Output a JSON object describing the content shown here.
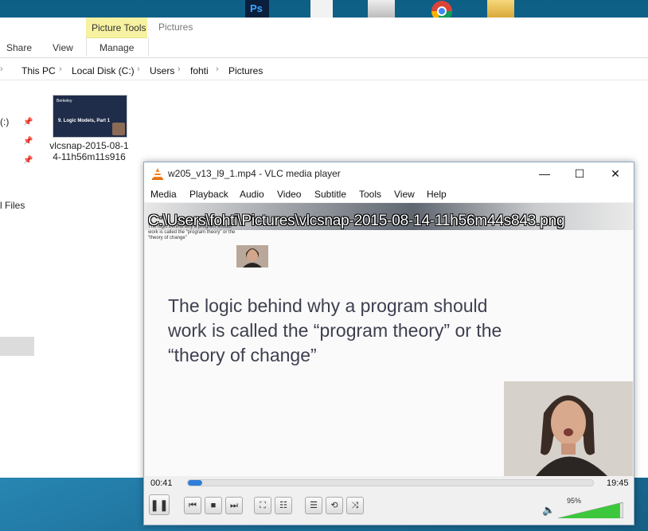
{
  "explorer": {
    "tabs": [
      "Share",
      "View"
    ],
    "contextual_group": "Picture Tools",
    "contextual_tab": "Manage",
    "contextual_tab2": "Pictures",
    "breadcrumb": [
      "This PC",
      "Local Disk (C:)",
      "Users",
      "fohti",
      "Pictures"
    ],
    "nav_partial": [
      "(:)",
      "l Files"
    ],
    "file": {
      "name": "vlcsnap-2015-08-14-11h56m11s916",
      "thumb_title": "9. Logic Models, Part 1",
      "thumb_logo": "Berkeley"
    }
  },
  "vlc": {
    "title": "w205_v13_l9_1.mp4 - VLC media player",
    "menu": [
      "Media",
      "Playback",
      "Audio",
      "Video",
      "Subtitle",
      "Tools",
      "View",
      "Help"
    ],
    "osd": "C:\\Users\\fohti\\Pictures\\vlcsnap-2015-08-14-11h56m44s843.png",
    "slide_small_text": "The logic behind why a program should work is called the “program theory” or the “theory of change”",
    "slide_text": "The logic behind why a program should work is called the “program theory” or the “theory of change”",
    "time_elapsed": "00:41",
    "time_total": "19:45",
    "progress": 0.035,
    "volume_label": "95%",
    "volume": 0.95
  },
  "colors": {
    "accent": "#2f7fd6",
    "picture_tools": "#f7f2a1",
    "volume_green": "#3cc73c"
  }
}
